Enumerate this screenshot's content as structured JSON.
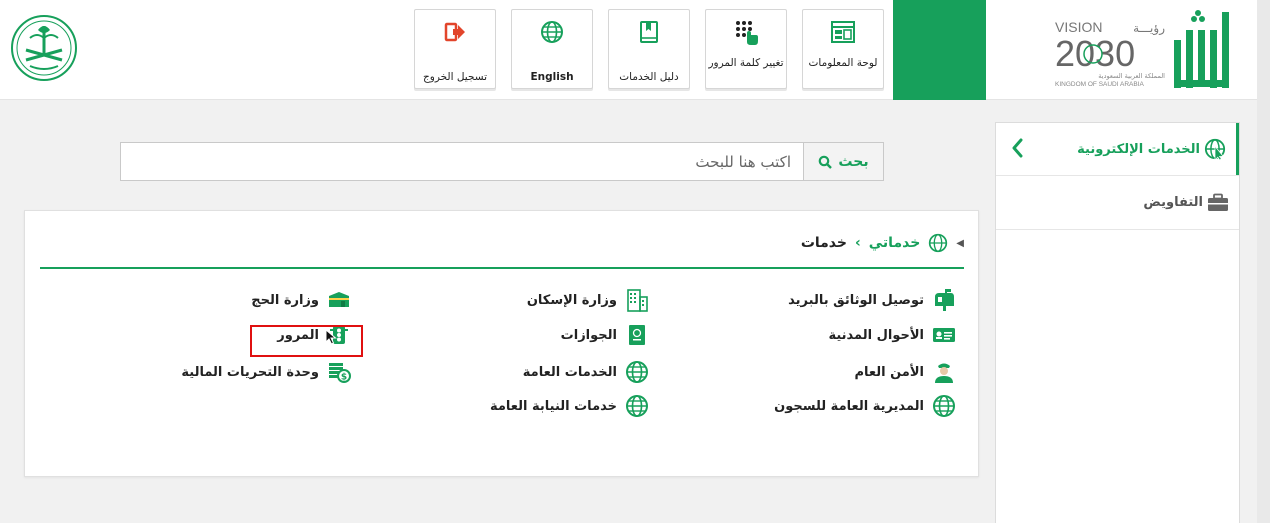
{
  "header": {
    "nav": [
      {
        "id": "logout",
        "label": "تسجيل الخروج",
        "icon": "sign-out-icon"
      },
      {
        "id": "english",
        "label": "English",
        "icon": "globe-icon"
      },
      {
        "id": "guide",
        "label": "دليل الخدمات",
        "icon": "book-icon"
      },
      {
        "id": "password",
        "label": "تغيير كلمة المرور",
        "icon": "keypad-icon"
      },
      {
        "id": "dashboard",
        "label": "لوحة المعلومات",
        "icon": "dashboard-icon"
      }
    ],
    "vision_logo": {
      "en": "VISION",
      "ar": "رؤيـــة",
      "year": "2030",
      "sub_ar": "المملكة العربية السعودية",
      "sub_en": "KINGDOM OF SAUDI ARABIA"
    },
    "brand_logo": "أبشر"
  },
  "search": {
    "button_label": "بحث",
    "placeholder": "اكتب هنا للبحث"
  },
  "breadcrumb": {
    "home": "خدماتي",
    "separator": "›",
    "current": "خدمات"
  },
  "services": {
    "col1": [
      {
        "label": "توصيل الوثائق بالبريد",
        "icon": "mailbox-icon"
      },
      {
        "label": "الأحوال المدنية",
        "icon": "id-card-icon"
      },
      {
        "label": "الأمن العام",
        "icon": "officer-icon"
      },
      {
        "label": "المديرية العامة للسجون",
        "icon": "globe-icon"
      }
    ],
    "col2": [
      {
        "label": "وزارة الإسكان",
        "icon": "building-icon"
      },
      {
        "label": "الجوازات",
        "icon": "passport-icon"
      },
      {
        "label": "الخدمات العامة",
        "icon": "globe-icon"
      },
      {
        "label": "خدمات النيابة العامة",
        "icon": "globe-icon"
      }
    ],
    "col3": [
      {
        "label": "وزارة الحج",
        "icon": "kaaba-icon"
      },
      {
        "label": "المرور",
        "icon": "traffic-icon"
      },
      {
        "label": "وحدة التحريات المالية",
        "icon": "money-icon"
      }
    ]
  },
  "sidebar": {
    "items": [
      {
        "label": "الخدمات الإلكترونية",
        "icon": "globe-icon",
        "active": true
      },
      {
        "label": "التفاويض",
        "icon": "briefcase-icon",
        "active": false
      }
    ]
  },
  "colors": {
    "brand_green": "#17a05b",
    "highlight_red": "#e01010",
    "logout_red": "#e2452b"
  }
}
